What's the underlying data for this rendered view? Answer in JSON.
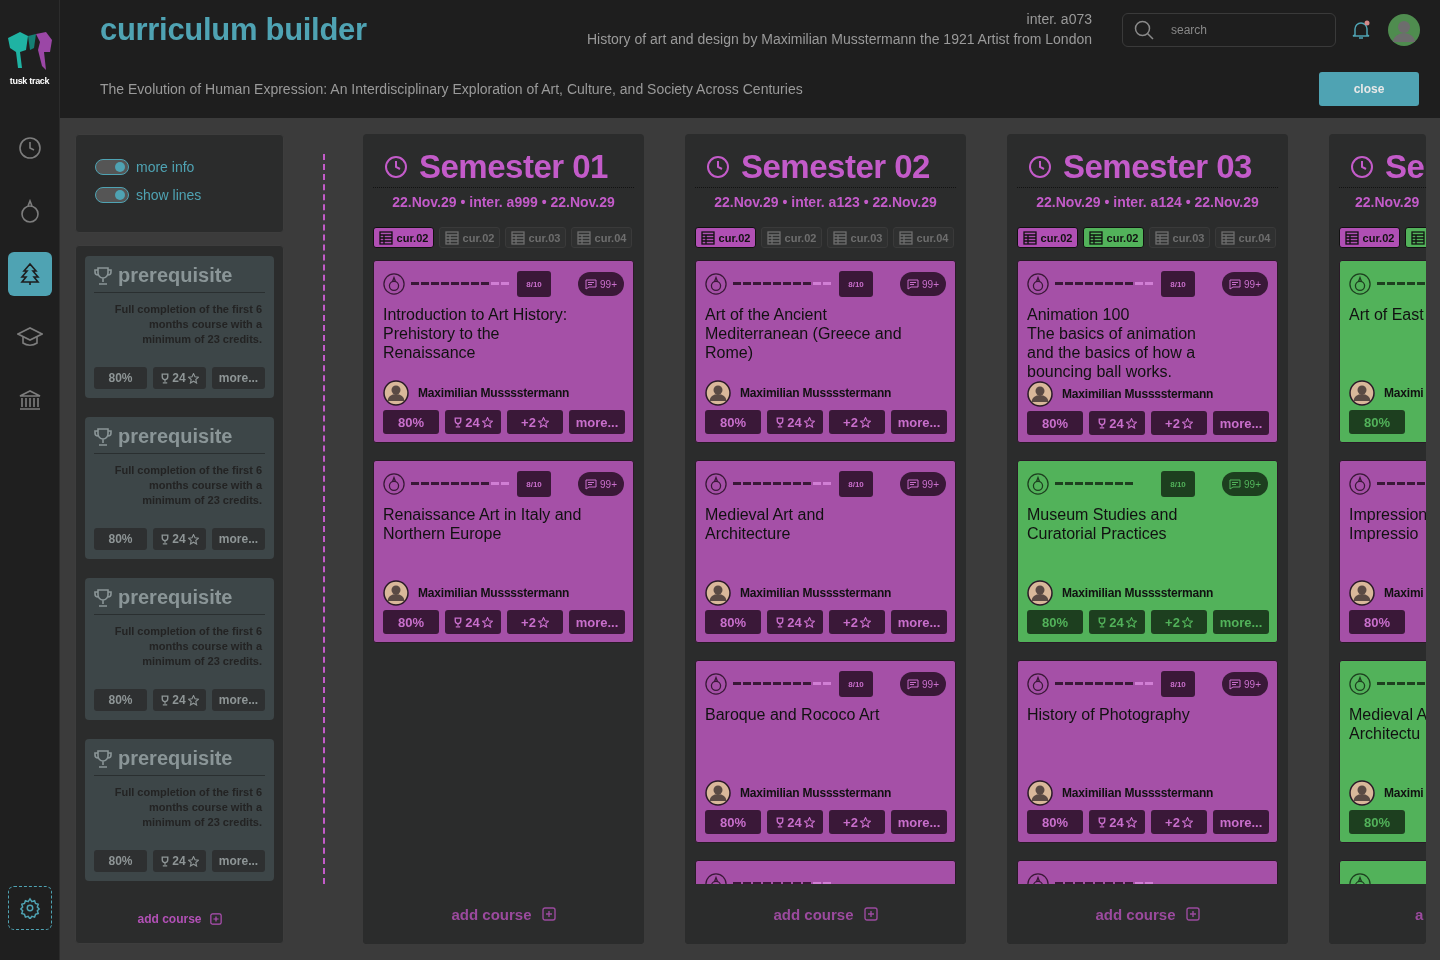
{
  "logo": {
    "text": "tusk track"
  },
  "nav": [
    {
      "selected": false
    },
    {
      "selected": false
    },
    {
      "selected": true
    },
    {
      "selected": false
    },
    {
      "selected": false
    }
  ],
  "header": {
    "title": "curriculum builder",
    "code": "inter. a073",
    "course": "History of art and design by Maximilian Musstermann the 1921 Artist from London",
    "search": {
      "placeholder": "search"
    },
    "notification": true,
    "subtitle": "The Evolution of Human Expression: An Interdisciplinary Exploration of Art, Culture, and Society Across Centuries",
    "close": "close"
  },
  "toggles": [
    {
      "label": "more info",
      "on": true
    },
    {
      "label": "show lines",
      "on": true
    }
  ],
  "prerequisites": {
    "items": [
      {
        "title": "prerequisite",
        "text": "Full completion of the first 6 months course with a minimum of 23 credits.",
        "percent": "80%",
        "points": "24",
        "more": "more..."
      },
      {
        "title": "prerequisite",
        "text": "Full completion of the first 6 months course with a minimum of 23 credits.",
        "percent": "80%",
        "points": "24",
        "more": "more..."
      },
      {
        "title": "prerequisite",
        "text": "Full completion of the first 6 months course with a minimum of 23 credits.",
        "percent": "80%",
        "points": "24",
        "more": "more..."
      },
      {
        "title": "prerequisite",
        "text": "Full completion of the first 6 months course with a minimum of 23 credits.",
        "percent": "80%",
        "points": "24",
        "more": "more..."
      }
    ],
    "add": "add course"
  },
  "semesters": [
    {
      "title": "Semester 01",
      "dates": "22.Nov.29 • inter. a999 • 22.Nov.29",
      "chips": [
        {
          "label": "cur.02",
          "kind": "purple"
        },
        {
          "label": "cur.02",
          "kind": "inactive"
        },
        {
          "label": "cur.03",
          "kind": "inactive"
        },
        {
          "label": "cur.04",
          "kind": "inactive"
        }
      ],
      "cards": [
        {
          "kind": "purple",
          "level": 0.8,
          "progress": "8/10",
          "comments": "99+",
          "title": "Introduction to Art History:\nPrehistory to the\nRenaissance",
          "author": "Maximilian Musssstermann",
          "percent": "80%",
          "points": "24",
          "bonus": "+2",
          "more": "more..."
        },
        {
          "kind": "purple",
          "level": 0.8,
          "progress": "8/10",
          "comments": "99+",
          "title": "Renaissance Art in Italy and\nNorthern Europe",
          "author": "Maximilian Musssstermann",
          "percent": "80%",
          "points": "24",
          "bonus": "+2",
          "more": "more..."
        }
      ],
      "add": "add course"
    },
    {
      "title": "Semester 02",
      "dates": "22.Nov.29 • inter. a123 • 22.Nov.29",
      "chips": [
        {
          "label": "cur.02",
          "kind": "purple"
        },
        {
          "label": "cur.02",
          "kind": "inactive"
        },
        {
          "label": "cur.03",
          "kind": "inactive"
        },
        {
          "label": "cur.04",
          "kind": "inactive"
        }
      ],
      "cards": [
        {
          "kind": "purple",
          "level": 0.8,
          "progress": "8/10",
          "comments": "99+",
          "title": "Art of the Ancient\nMediterranean (Greece and\nRome)",
          "author": "Maximilian Musssstermann",
          "percent": "80%",
          "points": "24",
          "bonus": "+2",
          "more": "more..."
        },
        {
          "kind": "purple",
          "level": 0.8,
          "progress": "8/10",
          "comments": "99+",
          "title": "Medieval Art and\nArchitecture",
          "author": "Maximilian Musssstermann",
          "percent": "80%",
          "points": "24",
          "bonus": "+2",
          "more": "more..."
        },
        {
          "kind": "purple",
          "level": 0.8,
          "progress": "8/10",
          "comments": "99+",
          "title": "Baroque and Rococo Art",
          "author": "Maximilian Musssstermann",
          "percent": "80%",
          "points": "24",
          "bonus": "+2",
          "more": "more..."
        },
        {
          "kind": "purple",
          "level": 0.8
        }
      ],
      "add": "add course"
    },
    {
      "title": "Semester 03",
      "dates": "22.Nov.29 • inter. a124 • 22.Nov.29",
      "chips": [
        {
          "label": "cur.02",
          "kind": "purple"
        },
        {
          "label": "cur.02",
          "kind": "green"
        },
        {
          "label": "cur.03",
          "kind": "inactive"
        },
        {
          "label": "cur.04",
          "kind": "inactive"
        }
      ],
      "cards": [
        {
          "kind": "purple",
          "level": 0.8,
          "progress": "8/10",
          "comments": "99+",
          "title": "Animation 100\nThe basics of animation\nand the basics of how a\nbouncing ball works.",
          "author": "Maximilian Musssstermann",
          "percent": "80%",
          "points": "24",
          "bonus": "+2",
          "more": "more..."
        },
        {
          "kind": "green",
          "level": 0.8,
          "progress": "8/10",
          "comments": "99+",
          "title": "Museum Studies and\nCuratorial Practices",
          "author": "Maximilian Musssstermann",
          "percent": "80%",
          "points": "24",
          "bonus": "+2",
          "more": "more..."
        },
        {
          "kind": "purple",
          "level": 0.8,
          "progress": "8/10",
          "comments": "99+",
          "title": "History of Photography",
          "author": "Maximilian Musssstermann",
          "percent": "80%",
          "points": "24",
          "bonus": "+2",
          "more": "more..."
        },
        {
          "kind": "purple",
          "level": 0.8
        }
      ],
      "add": "add course"
    },
    {
      "title": "Se",
      "dates": "22.Nov.29",
      "chips": [
        {
          "label": "cur.02",
          "kind": "purple"
        },
        {
          "kind": "green"
        }
      ],
      "cards": [
        {
          "kind": "green",
          "level": 0.8,
          "title": "Art of East",
          "author": "Maximi",
          "percent": "80%"
        },
        {
          "kind": "purple",
          "level": 0.8,
          "title": "Impression\nImpressio",
          "author": "Maximi",
          "percent": "80%"
        },
        {
          "kind": "green",
          "level": 0.8,
          "title": "Medieval A\nArchitectu",
          "author": "Maximi",
          "percent": "80%"
        },
        {
          "kind": "green"
        }
      ],
      "add": "a"
    }
  ]
}
